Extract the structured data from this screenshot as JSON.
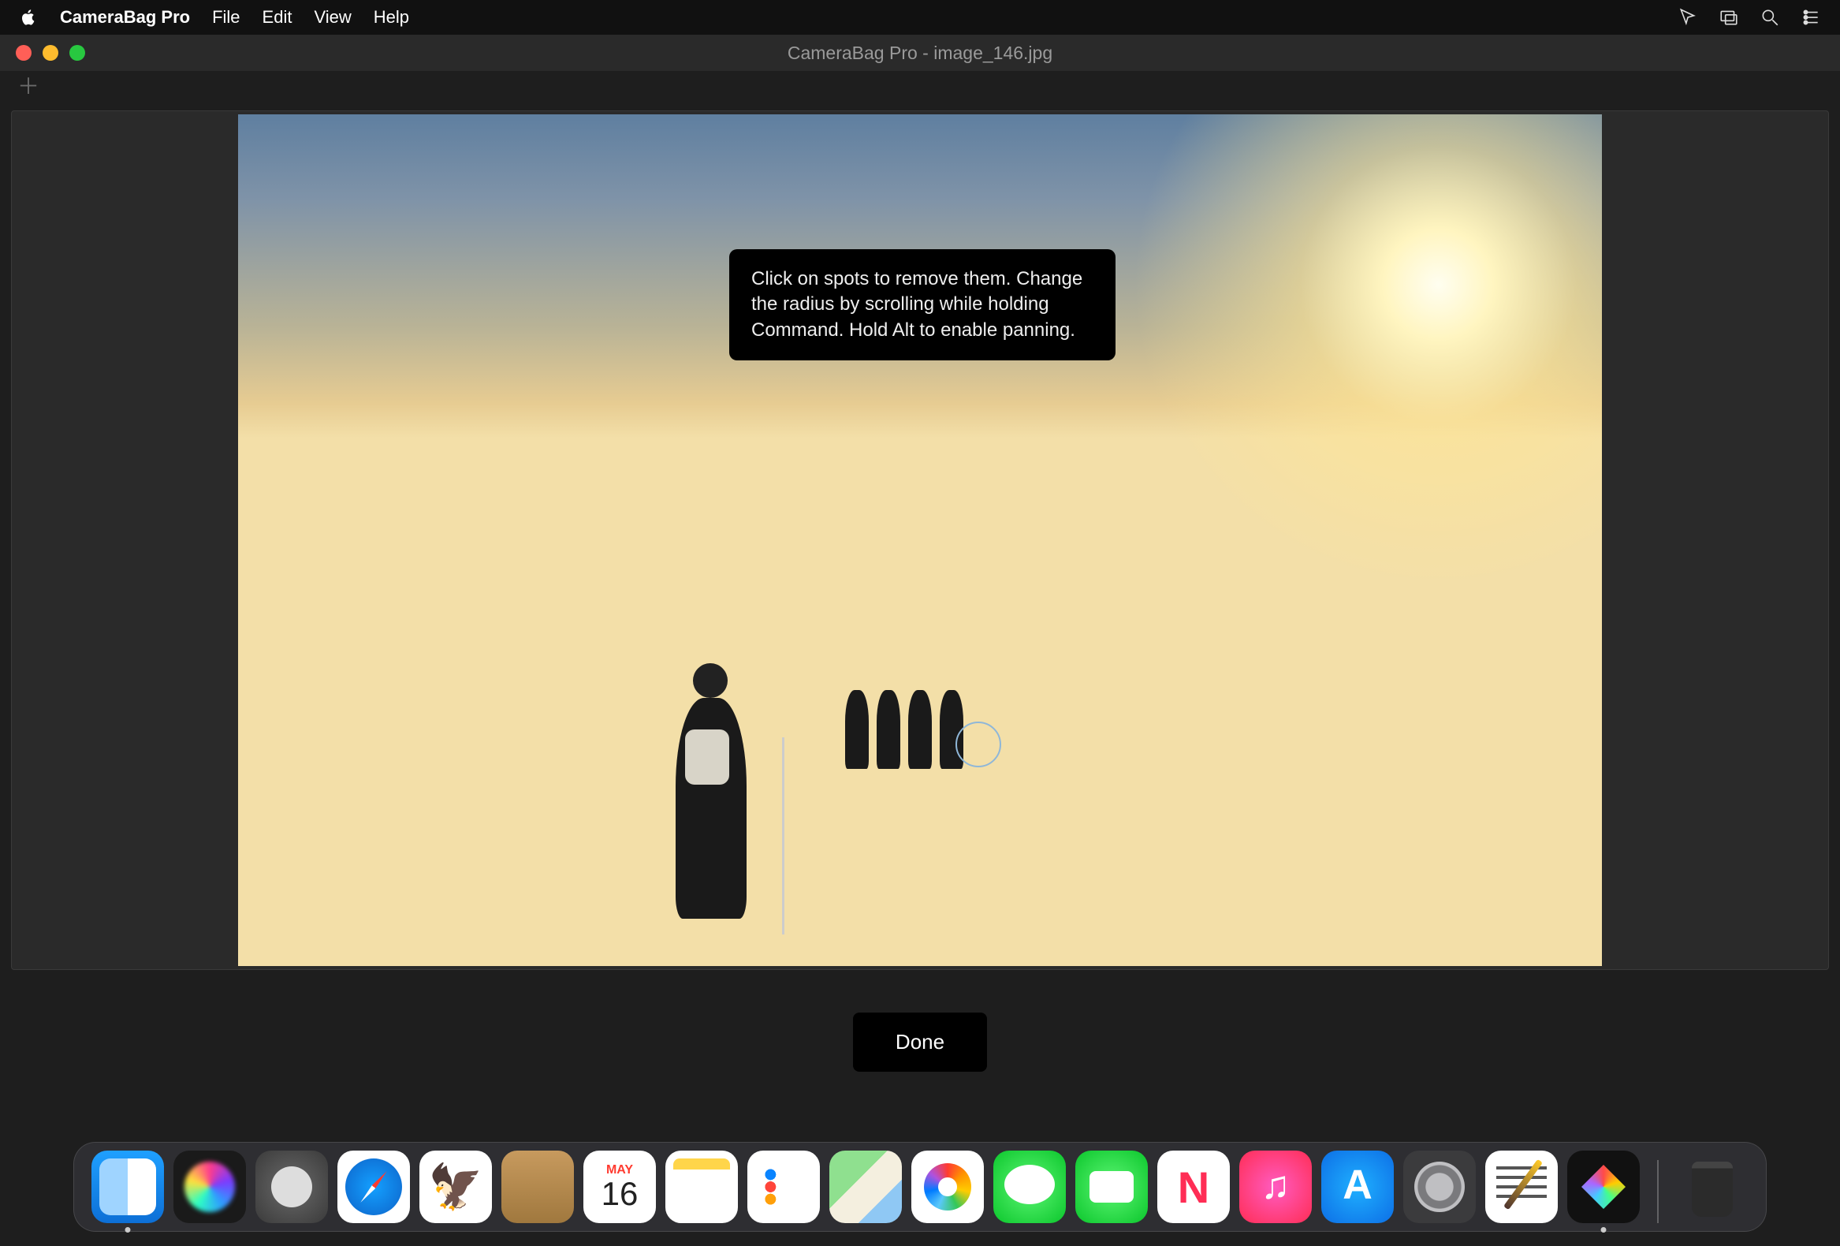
{
  "menubar": {
    "app_name": "CameraBag Pro",
    "items": [
      "File",
      "Edit",
      "View",
      "Help"
    ]
  },
  "window": {
    "title": "CameraBag Pro - image_146.jpg"
  },
  "tooltip": {
    "text": "Click on spots to remove them. Change the radius by scrolling while holding Command. Hold Alt to enable panning."
  },
  "actions": {
    "done_label": "Done"
  },
  "calendar": {
    "month": "MAY",
    "day": "16"
  },
  "dock": {
    "items": [
      {
        "name": "finder",
        "running": true
      },
      {
        "name": "siri"
      },
      {
        "name": "launchpad"
      },
      {
        "name": "safari"
      },
      {
        "name": "mail"
      },
      {
        "name": "contacts"
      },
      {
        "name": "calendar"
      },
      {
        "name": "notes"
      },
      {
        "name": "reminders"
      },
      {
        "name": "maps"
      },
      {
        "name": "photos"
      },
      {
        "name": "messages"
      },
      {
        "name": "facetime"
      },
      {
        "name": "news"
      },
      {
        "name": "music"
      },
      {
        "name": "appstore"
      },
      {
        "name": "settings"
      },
      {
        "name": "textedit"
      },
      {
        "name": "camerabag",
        "running": true
      }
    ]
  }
}
